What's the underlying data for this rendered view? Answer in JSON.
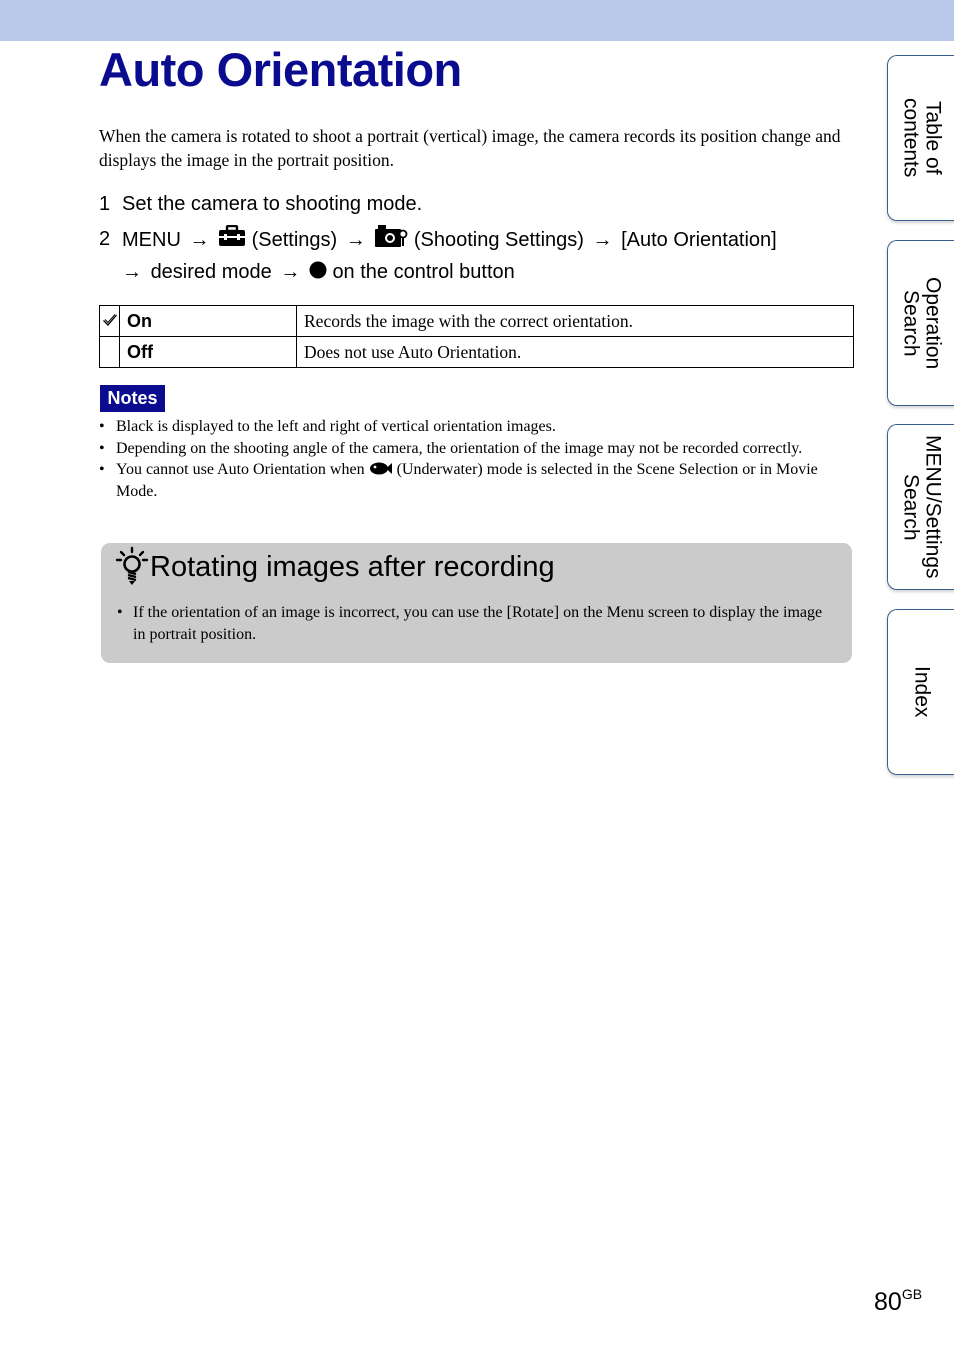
{
  "page": {
    "title": "Auto Orientation",
    "intro": "When the camera is rotated to shoot a portrait (vertical) image, the camera records its position change and displays the image in the portrait position.",
    "steps": [
      {
        "num": "1",
        "text": "Set the camera to shooting mode."
      },
      {
        "num": "2",
        "menu": "MENU",
        "settings_label": "(Settings)",
        "shooting_settings_label": "(Shooting Settings)",
        "item_label": "[Auto Orientation]",
        "desired_mode": "desired mode",
        "control_text": "on the control button",
        "arrow": "→"
      }
    ],
    "options": [
      {
        "default": true,
        "name": "On",
        "description": "Records the image with the correct orientation."
      },
      {
        "default": false,
        "name": "Off",
        "description": "Does not use Auto Orientation."
      }
    ],
    "notes": {
      "label": "Notes",
      "items": [
        "Black is displayed to the left and right of vertical orientation images.",
        "Depending on the shooting angle of the camera, the orientation of the image may not be recorded correctly."
      ],
      "underwater_prefix": "You cannot use Auto Orientation when",
      "underwater_suffix": "(Underwater) mode is selected in the Scene Selection or in Movie Mode."
    },
    "tip": {
      "title": "Rotating images after recording",
      "items": [
        "If the orientation of an image is incorrect, you can use the [Rotate] on the Menu screen to display the image in portrait position."
      ]
    },
    "page_number": "80",
    "page_suffix": "GB"
  },
  "side_tabs": [
    {
      "label": "Table of\ncontents"
    },
    {
      "label": "Operation\nSearch"
    },
    {
      "label": "MENU/Settings\nSearch"
    },
    {
      "label": "Index"
    }
  ],
  "colors": {
    "header_band": "#b9c8ea",
    "title": "#0b0b8f",
    "notes_badge": "#0b0b8f",
    "tip_box": "#cbcbcb",
    "tab_border": "#3a5f8e"
  }
}
